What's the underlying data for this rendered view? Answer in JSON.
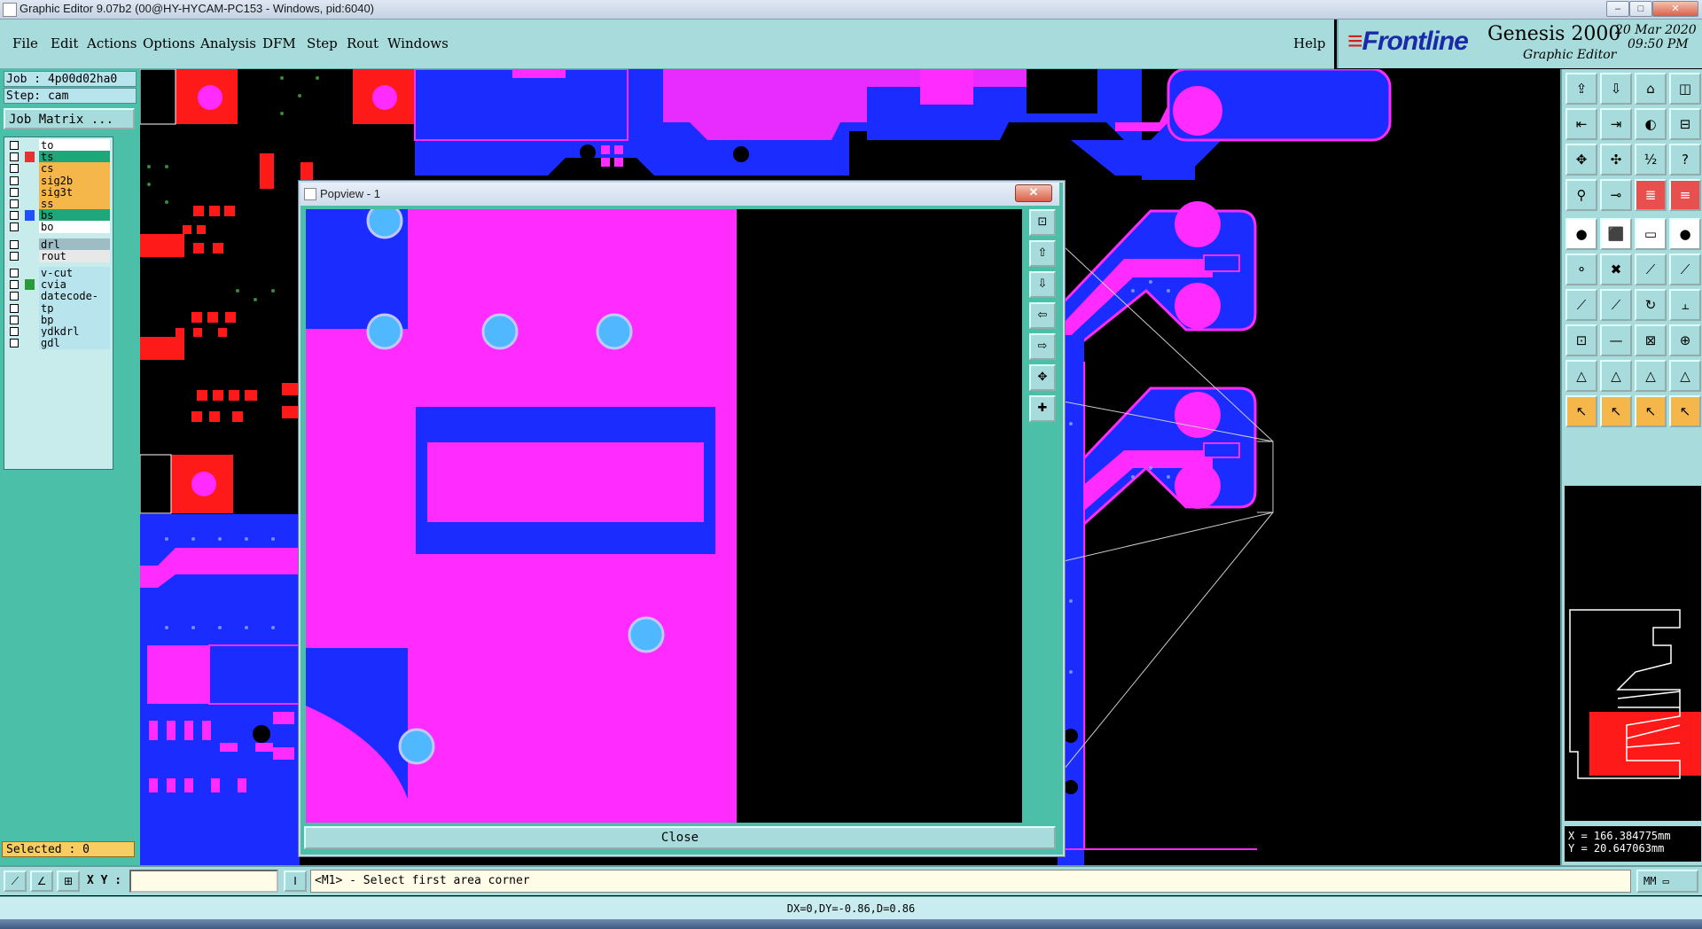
{
  "window": {
    "title": "Graphic Editor 9.07b2 (00@HY-HYCAM-PC153 - Windows, pid:6040)"
  },
  "menu": [
    "File",
    "Edit",
    "Actions",
    "Options",
    "Analysis",
    "DFM",
    "Step",
    "Rout",
    "Windows"
  ],
  "help_label": "Help",
  "brand": {
    "logo": "Frontline",
    "product": "Genesis 2000",
    "subtitle": "Graphic Editor",
    "date": "20 Mar 2020",
    "time": "09:50 PM"
  },
  "job": {
    "job_line": "Job : 4p00d02ha0",
    "step_line": "Step: cam",
    "matrix_button": "Job Matrix ..."
  },
  "layers": [
    {
      "name": "to",
      "bg": "#ffffff",
      "swatch": ""
    },
    {
      "name": "ts",
      "bg": "#1fa67a",
      "swatch": "#e83030"
    },
    {
      "name": "cs",
      "bg": "#f5b64a",
      "swatch": ""
    },
    {
      "name": "sig2b",
      "bg": "#f5b64a",
      "swatch": ""
    },
    {
      "name": "sig3t",
      "bg": "#f5b64a",
      "swatch": ""
    },
    {
      "name": "ss",
      "bg": "#f5b64a",
      "swatch": ""
    },
    {
      "name": "bs",
      "bg": "#1fa67a",
      "swatch": "#2050ff"
    },
    {
      "name": "bo",
      "bg": "#ffffff",
      "swatch": ""
    },
    {
      "name": "drl",
      "bg": "#9ebcc4",
      "swatch": ""
    },
    {
      "name": "rout",
      "bg": "#e8e8e8",
      "swatch": ""
    },
    {
      "name": "v-cut",
      "bg": "#b8e4ee",
      "swatch": ""
    },
    {
      "name": "cvia",
      "bg": "#b8e4ee",
      "swatch": "#2a9a3a"
    },
    {
      "name": "datecode-to",
      "bg": "#b8e4ee",
      "swatch": ""
    },
    {
      "name": "tp",
      "bg": "#b8e4ee",
      "swatch": ""
    },
    {
      "name": "bp",
      "bg": "#b8e4ee",
      "swatch": ""
    },
    {
      "name": "ydkdrl",
      "bg": "#b8e4ee",
      "swatch": ""
    },
    {
      "name": "gdl",
      "bg": "#b8e4ee",
      "swatch": ""
    }
  ],
  "selected": "Selected : 0",
  "popview": {
    "title": "Popview - 1",
    "close_label": "Close"
  },
  "coords": {
    "x": "X = 166.384775mm",
    "y": "Y =  20.647063mm"
  },
  "command": {
    "xy_label": "X Y :",
    "prompt": "<M1> - Select first area corner",
    "units": "MM"
  },
  "status": "DX=0,DY=-0.86,D=0.86",
  "colors": {
    "magenta": "#ff2bff",
    "blue": "#1a2cff",
    "red": "#ff1a1a",
    "teal": "#4cbfa8",
    "panel": "#a8dcdc"
  },
  "tools": [
    "open-icon",
    "save-icon",
    "home-icon",
    "window-icon",
    "zoom-in-icon",
    "zoom-out-icon",
    "pan-icon",
    "layout-icon",
    "fit-icon",
    "center-icon",
    "ratio-icon",
    "help-icon",
    "measure-icon",
    "snap-icon",
    "layers-icon",
    "layers-alt-icon",
    "pad-icon",
    "feature-icon",
    "ruler-icon",
    "circle-icon",
    "net-icon",
    "cross-icon",
    "connect-icon",
    "link-icon",
    "line-icon",
    "line-alt-icon",
    "arc-icon",
    "shape-icon",
    "select-icon",
    "minus-icon",
    "resize-icon",
    "group-icon",
    "triangle-icon",
    "triangle-a-icon",
    "triangle-b-icon",
    "triangle-c-icon",
    "pointer-icon",
    "pointer-alt-icon",
    "pointer-b-icon",
    "pointer-c-icon"
  ]
}
